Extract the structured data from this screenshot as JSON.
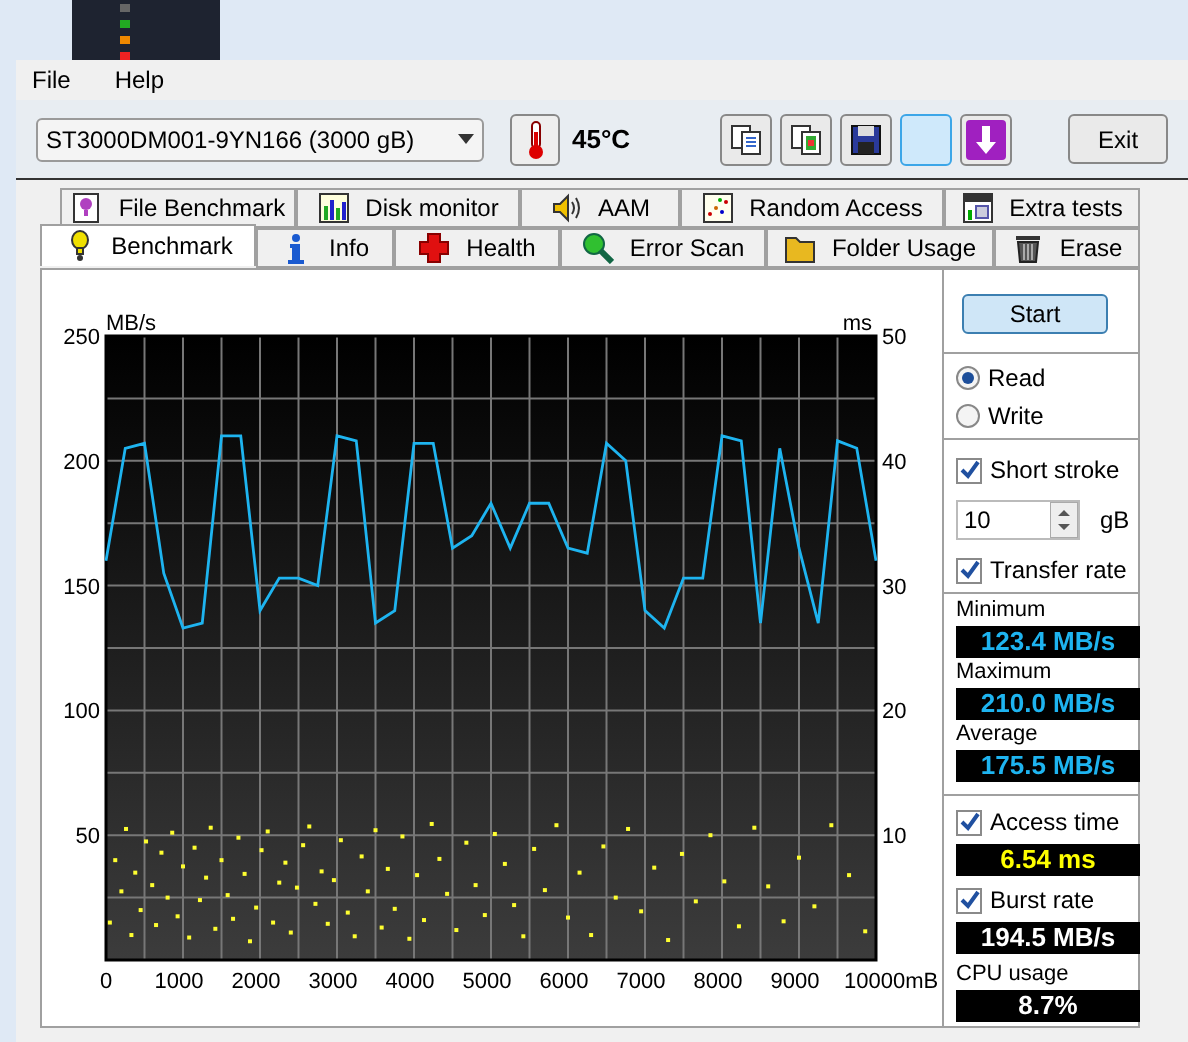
{
  "menu": [
    {
      "label": "File"
    },
    {
      "label": "Help"
    }
  ],
  "toolbar": {
    "drive": "ST3000DM001-9YN166 (3000 gB)",
    "temperature": "45°C",
    "tool_buttons": [
      {
        "kind": "copy",
        "highlighted": false
      },
      {
        "kind": "screenshot",
        "highlighted": false
      },
      {
        "kind": "save",
        "highlighted": false
      },
      {
        "kind": "blank",
        "highlighted": true
      },
      {
        "kind": "download",
        "highlighted": false
      }
    ],
    "exit": "Exit"
  },
  "tabs_top": [
    {
      "label": "File Benchmark",
      "kind": "file",
      "selected": false
    },
    {
      "label": "Disk monitor",
      "kind": "monitor",
      "selected": false
    },
    {
      "label": "AAM",
      "kind": "sound",
      "selected": false
    },
    {
      "label": "Random Access",
      "kind": "random",
      "selected": false
    },
    {
      "label": "Extra tests",
      "kind": "extra",
      "selected": false
    }
  ],
  "tabs_bottom": [
    {
      "label": "Benchmark",
      "kind": "bench",
      "selected": true
    },
    {
      "label": "Info",
      "kind": "info",
      "selected": false
    },
    {
      "label": "Health",
      "kind": "health",
      "selected": false
    },
    {
      "label": "Error Scan",
      "kind": "scan",
      "selected": false
    },
    {
      "label": "Folder Usage",
      "kind": "folder",
      "selected": false
    },
    {
      "label": "Erase",
      "kind": "erase",
      "selected": false
    }
  ],
  "benchmark": {
    "chart_data": {
      "type": "line",
      "ylabel": "MB/s",
      "xlim": [
        0,
        10000
      ],
      "ylim": [
        0,
        250
      ],
      "x": [
        0,
        250,
        500,
        750,
        1000,
        1250,
        1500,
        1750,
        2000,
        2250,
        2500,
        2750,
        3000,
        3250,
        3500,
        3750,
        4000,
        4250,
        4500,
        4750,
        5000,
        5250,
        5500,
        5750,
        6000,
        6250,
        6500,
        6750,
        7000,
        7250,
        7500,
        7750,
        8000,
        8250,
        8500,
        8750,
        9000,
        9250,
        9500,
        9750,
        10000
      ],
      "grid": true,
      "series": [
        {
          "color": "#1eb4f0",
          "values": [
            160,
            205,
            207,
            155,
            133,
            135,
            210,
            210,
            140,
            153,
            153,
            150,
            210,
            208,
            135,
            140,
            207,
            207,
            165,
            170,
            183,
            165,
            183,
            183,
            165,
            163,
            207,
            200,
            140,
            133,
            153,
            153,
            210,
            208,
            135,
            205,
            165,
            135,
            208,
            205,
            160
          ]
        }
      ],
      "xticks": [
        {
          "value": 0,
          "label": "0"
        },
        {
          "value": 1000,
          "label": "1000"
        },
        {
          "value": 2000,
          "label": "2000"
        },
        {
          "value": 3000,
          "label": "3000"
        },
        {
          "value": 4000,
          "label": "4000"
        },
        {
          "value": 5000,
          "label": "5000"
        },
        {
          "value": 6000,
          "label": "6000"
        },
        {
          "value": 7000,
          "label": "7000"
        },
        {
          "value": 8000,
          "label": "8000"
        },
        {
          "value": 9000,
          "label": "9000"
        },
        {
          "value": 10000,
          "label": "10000mB"
        }
      ],
      "yticks": [
        50,
        100,
        150,
        200,
        250
      ]
    },
    "access_time_plot": {
      "chart_data": {
        "type": "scatter",
        "ylabel": "ms",
        "xlim": [
          0,
          10000
        ],
        "ylim": [
          0,
          50
        ],
        "yticks": [
          10,
          20,
          30,
          40,
          50
        ],
        "x": [
          50,
          120,
          200,
          260,
          330,
          380,
          450,
          520,
          600,
          650,
          720,
          800,
          860,
          930,
          1000,
          1080,
          1150,
          1220,
          1300,
          1360,
          1420,
          1500,
          1580,
          1650,
          1720,
          1800,
          1870,
          1950,
          2020,
          2100,
          2170,
          2250,
          2330,
          2400,
          2480,
          2560,
          2640,
          2720,
          2800,
          2880,
          2960,
          3050,
          3140,
          3230,
          3320,
          3400,
          3500,
          3580,
          3660,
          3750,
          3850,
          3940,
          4040,
          4130,
          4230,
          4330,
          4430,
          4550,
          4680,
          4800,
          4920,
          5050,
          5180,
          5300,
          5420,
          5560,
          5700,
          5850,
          6000,
          6150,
          6300,
          6460,
          6620,
          6780,
          6950,
          7120,
          7300,
          7480,
          7660,
          7850,
          8030,
          8220,
          8420,
          8600,
          8800,
          9000,
          9200,
          9420,
          9650,
          9860
        ],
        "series": [
          {
            "color": "#ffff30",
            "values": [
              3,
              8,
              5.5,
              10.5,
              2,
              7,
              4,
              9.5,
              6,
              2.8,
              8.6,
              5,
              10.2,
              3.5,
              7.5,
              1.8,
              9,
              4.8,
              6.6,
              10.6,
              2.5,
              8,
              5.2,
              3.3,
              9.8,
              6.9,
              1.5,
              4.2,
              8.8,
              10.3,
              3,
              6.2,
              7.8,
              2.2,
              5.8,
              9.2,
              10.7,
              4.5,
              7.1,
              2.9,
              6.4,
              9.6,
              3.8,
              1.9,
              8.3,
              5.5,
              10.4,
              2.6,
              7.3,
              4.1,
              9.9,
              1.7,
              6.8,
              3.2,
              10.9,
              8.1,
              5.3,
              2.4,
              9.4,
              6,
              3.6,
              10.1,
              7.7,
              4.4,
              1.9,
              8.9,
              5.6,
              10.8,
              3.4,
              7,
              2,
              9.1,
              5,
              10.5,
              3.9,
              7.4,
              1.6,
              8.5,
              4.7,
              10,
              6.3,
              2.7,
              10.6,
              5.9,
              3.1,
              8.2,
              4.3,
              10.8,
              6.8,
              2.3
            ]
          }
        ]
      }
    }
  },
  "controls": {
    "start": "Start",
    "mode": [
      {
        "label": "Read",
        "selected": true
      },
      {
        "label": "Write",
        "selected": false
      }
    ],
    "short_stroke": {
      "label": "Short stroke",
      "checked": true
    },
    "stroke_size": {
      "value": "10",
      "unit": "gB"
    },
    "transfer_rate": {
      "label": "Transfer rate",
      "checked": true
    },
    "stats": [
      {
        "label": "Minimum",
        "reading": "123.4 MB/s"
      },
      {
        "label": "Maximum",
        "reading": "210.0 MB/s"
      },
      {
        "label": "Average",
        "reading": "175.5 MB/s"
      }
    ],
    "access_time": {
      "label": "Access time",
      "checked": true,
      "reading": "6.54 ms"
    },
    "burst_rate": {
      "label": "Burst rate",
      "checked": true,
      "reading": "194.5 MB/s"
    },
    "cpu": {
      "label": "CPU usage",
      "reading": "8.7%"
    }
  }
}
